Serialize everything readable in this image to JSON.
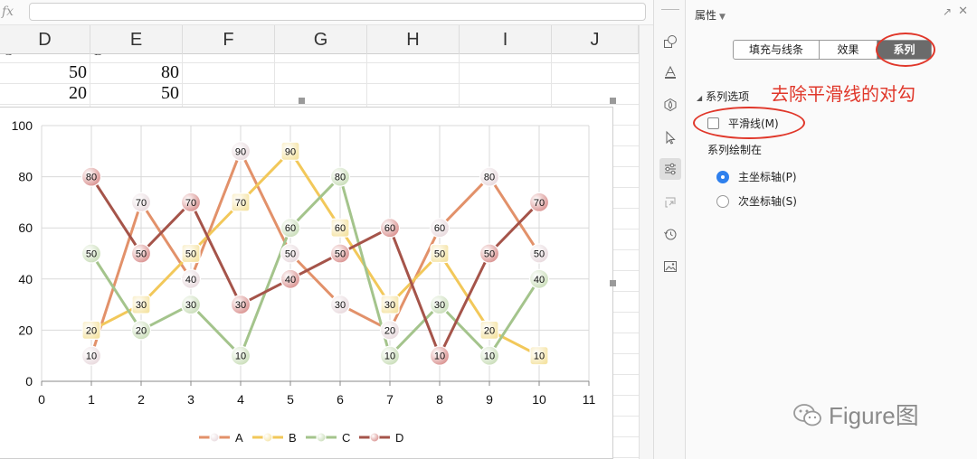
{
  "formula_bar": {
    "fx_label": "fx",
    "value": ""
  },
  "columns": [
    "D",
    "E",
    "F",
    "G",
    "H",
    "I",
    "J"
  ],
  "cells": [
    {
      "col": "D",
      "row": 1,
      "text": "C"
    },
    {
      "col": "E",
      "row": 1,
      "text": "D"
    },
    {
      "col": "D",
      "row": 2,
      "text": "50"
    },
    {
      "col": "E",
      "row": 2,
      "text": "80"
    },
    {
      "col": "D",
      "row": 3,
      "text": "20"
    },
    {
      "col": "E",
      "row": 3,
      "text": "50"
    }
  ],
  "chart_data": {
    "type": "line",
    "x": [
      1,
      2,
      3,
      4,
      5,
      6,
      7,
      8,
      9,
      10
    ],
    "xlim": [
      0,
      11
    ],
    "ylim": [
      0,
      100
    ],
    "x_ticks": [
      "0",
      "1",
      "2",
      "3",
      "4",
      "5",
      "6",
      "7",
      "8",
      "9",
      "10",
      "11"
    ],
    "y_ticks": [
      "0",
      "20",
      "40",
      "60",
      "80",
      "100"
    ],
    "grid": true,
    "legend_position": "bottom",
    "data_labels": true,
    "series": [
      {
        "name": "A",
        "values": [
          10,
          70,
          40,
          90,
          50,
          30,
          20,
          60,
          80,
          50
        ],
        "color": "#e2916a",
        "marker_color": "#e8d9dd",
        "marker": "circle"
      },
      {
        "name": "B",
        "values": [
          20,
          30,
          50,
          70,
          90,
          60,
          30,
          50,
          20,
          10
        ],
        "color": "#f2c85a",
        "marker_color": "#f5e4a6",
        "marker": "square"
      },
      {
        "name": "C",
        "values": [
          50,
          20,
          30,
          10,
          60,
          80,
          10,
          30,
          10,
          40
        ],
        "color": "#a4c48c",
        "marker_color": "#c9ddb8",
        "marker": "circle"
      },
      {
        "name": "D",
        "values": [
          80,
          50,
          70,
          30,
          40,
          50,
          60,
          10,
          50,
          70
        ],
        "color": "#a5544a",
        "marker_color": "#d9908e",
        "marker": "circle"
      }
    ]
  },
  "toolbar": {
    "icons": [
      "shapes-icon",
      "text-fill-icon",
      "effects-icon",
      "select-cursor-icon",
      "series-options-icon",
      "transfer-icon",
      "history-icon",
      "image-icon"
    ]
  },
  "panel": {
    "title": "属性",
    "tabs": [
      "填充与线条",
      "效果",
      "系列"
    ],
    "active_tab": "系列",
    "section_label": "系列选项",
    "smooth_label": "平滑线(M)",
    "smooth_checked": false,
    "plot_on_label": "系列绘制在",
    "radio_primary": "主坐标轴(P)",
    "radio_secondary": "次坐标轴(S)",
    "annotation": "去除平滑线的对勾",
    "accent_color": "#e0372a"
  },
  "watermark": {
    "text": "Figure图"
  }
}
